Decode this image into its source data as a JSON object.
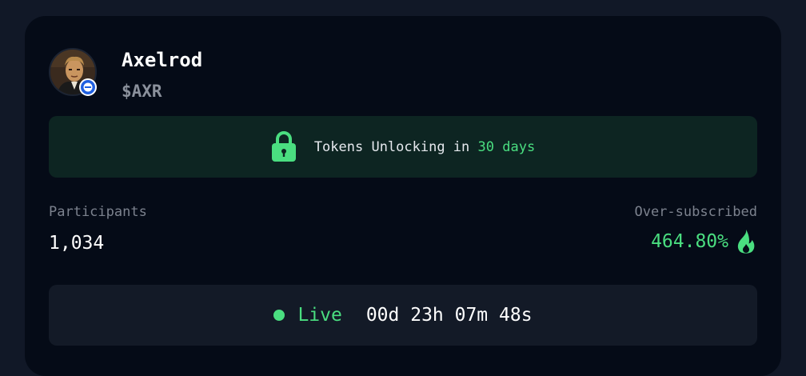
{
  "token": {
    "name": "Axelrod",
    "symbol": "$AXR",
    "avatar_icon": "portrait-avatar",
    "chain_icon": "base-chain-icon"
  },
  "unlock": {
    "icon": "lock-icon",
    "text": "Tokens Unlocking in",
    "days": "30 days"
  },
  "stats": {
    "participants_label": "Participants",
    "participants_value": "1,034",
    "oversubscribed_label": "Over-subscribed",
    "oversubscribed_value": "464.80%",
    "oversubscribed_icon": "fire-icon"
  },
  "status": {
    "label": "Live",
    "countdown": "00d 23h 07m 48s"
  },
  "colors": {
    "accent_green": "#4ade80",
    "page_bg": "#111827",
    "card_bg": "#050b17",
    "banner_bg": "#0d2522",
    "bar_bg": "#131a27"
  }
}
